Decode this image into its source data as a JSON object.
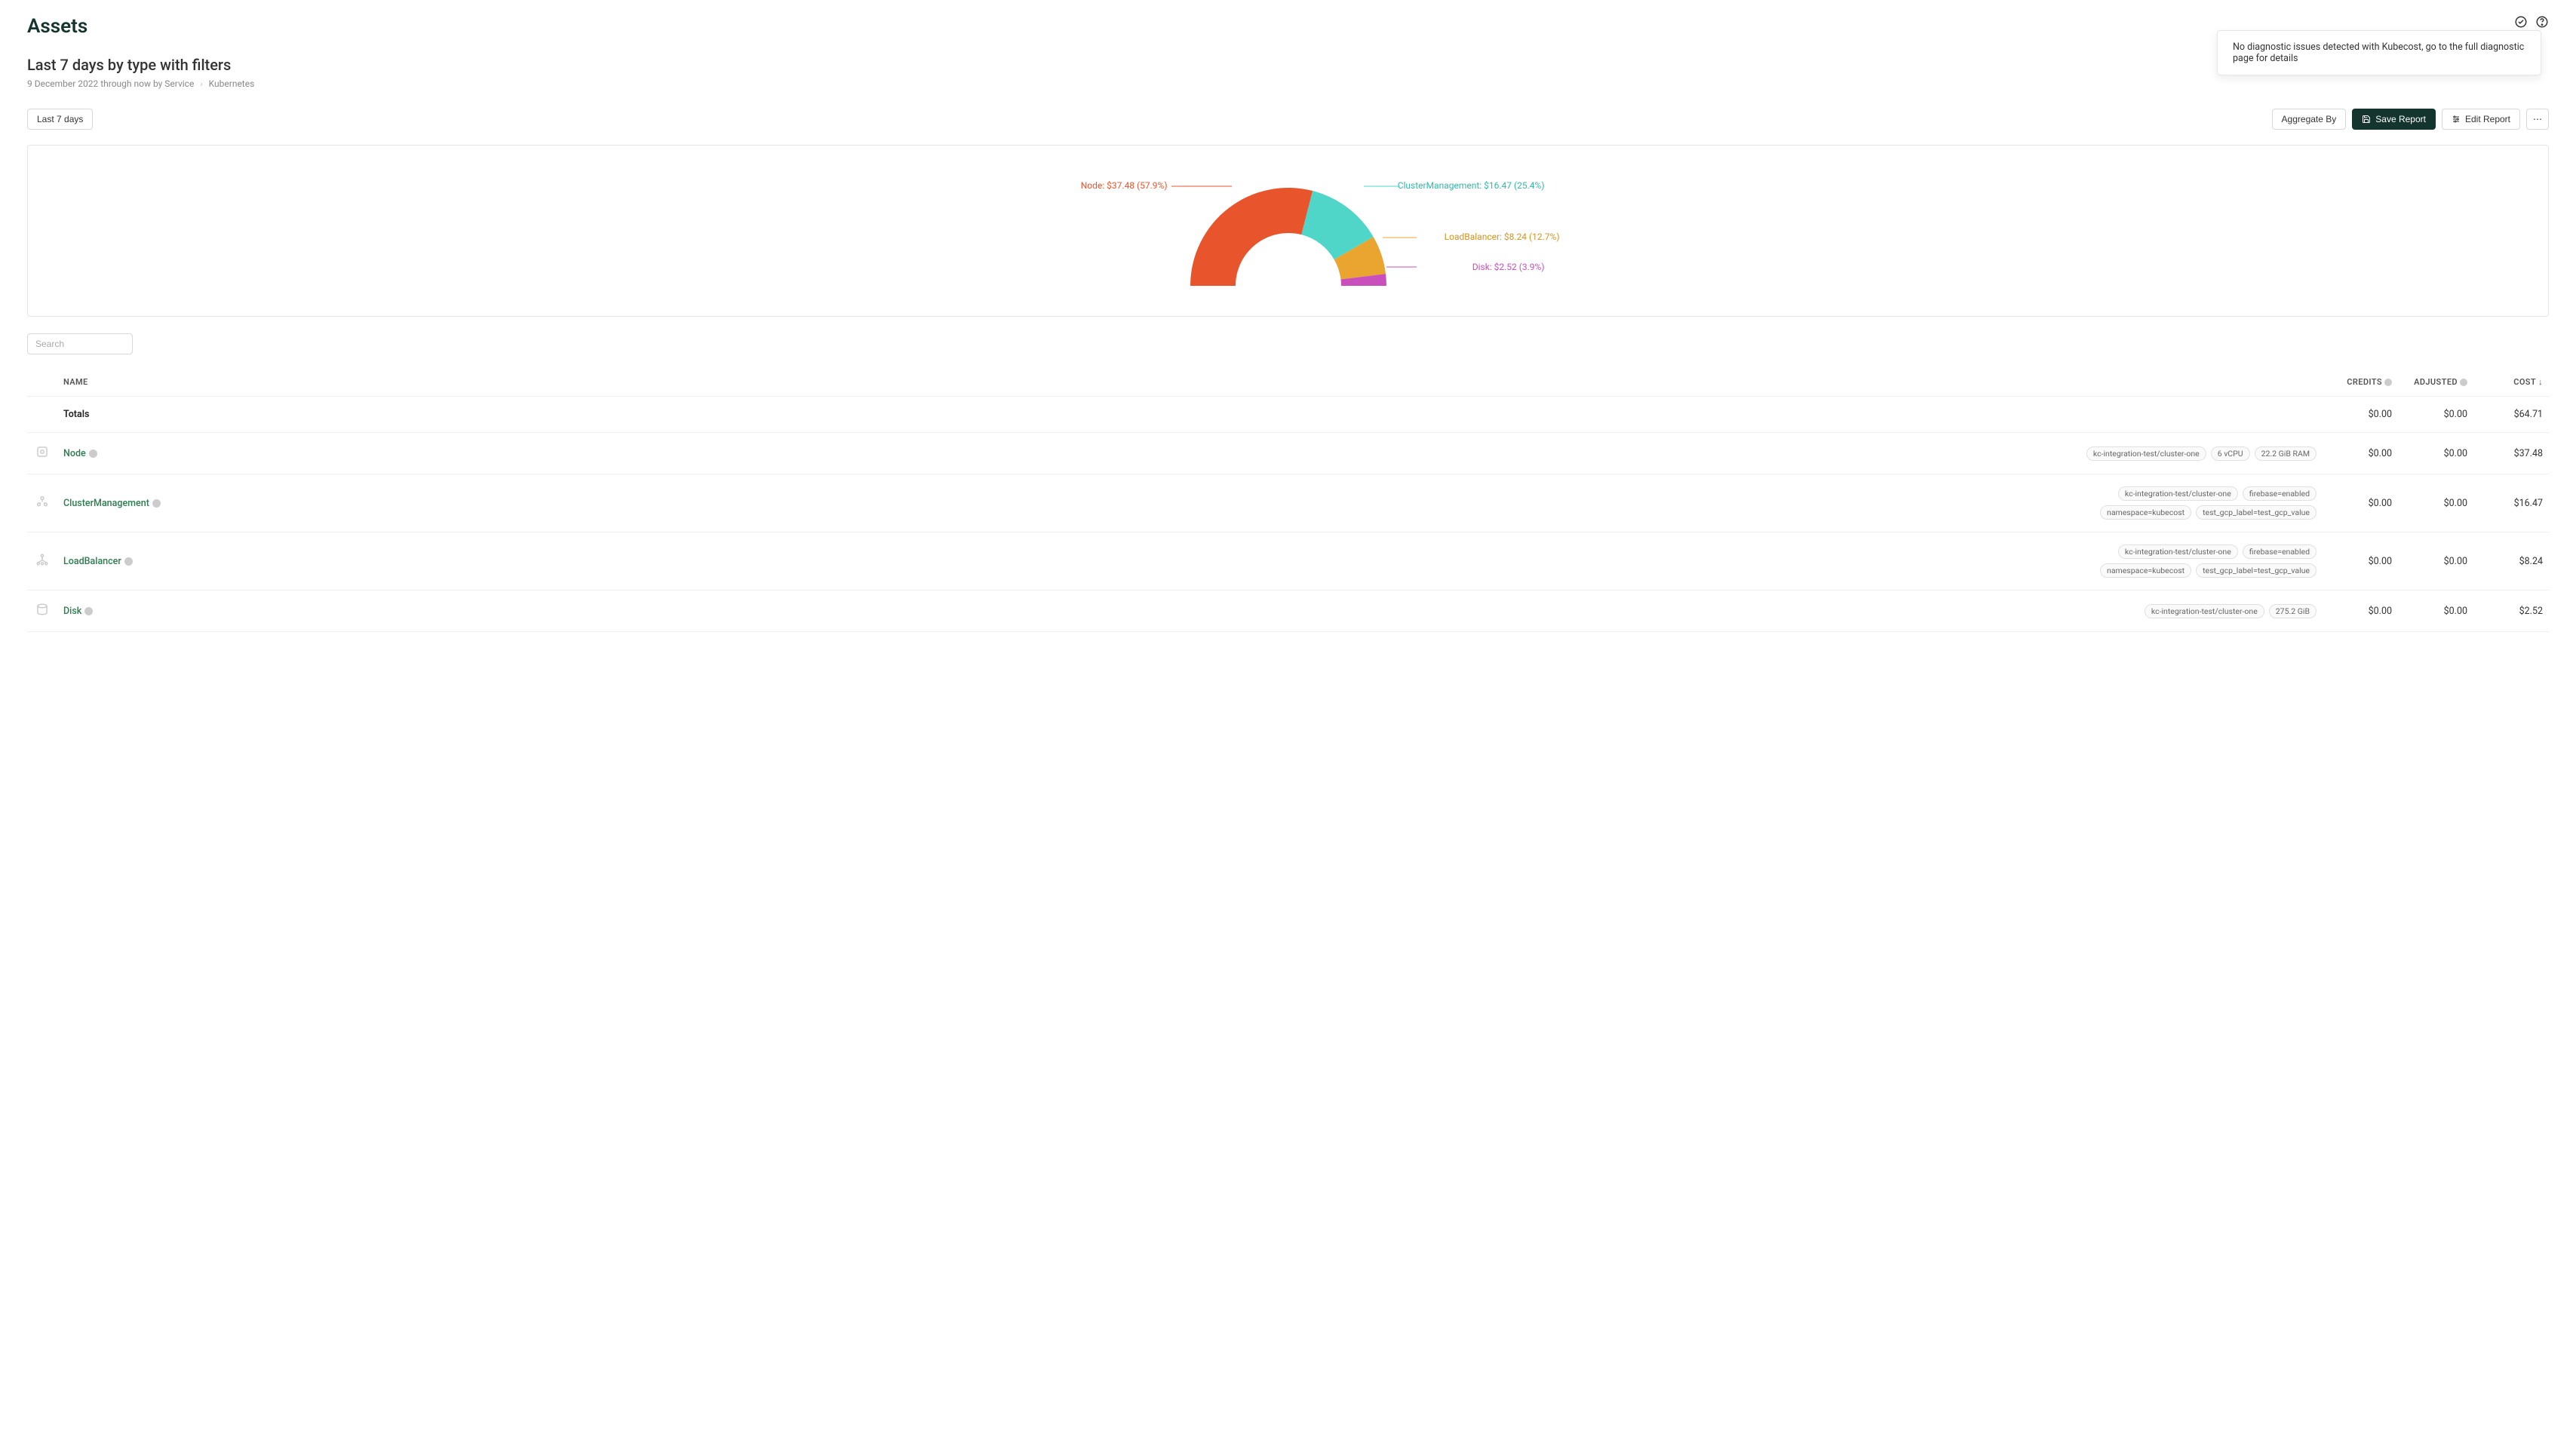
{
  "header": {
    "page_title": "Assets",
    "notification": "No diagnostic issues detected with Kubecost, go to the full diagnostic page for details"
  },
  "subheader": {
    "report_title": "Last 7 days by type with filters",
    "breadcrumb_prefix": "9 December 2022 through now by Service",
    "breadcrumb_leaf": "Kubernetes"
  },
  "toolbar": {
    "range_label": "Last 7 days",
    "aggregate_label": "Aggregate By",
    "save_label": "Save Report",
    "edit_label": "Edit Report",
    "more_label": "⋯"
  },
  "chart_data": {
    "type": "pie",
    "title": "",
    "slices": [
      {
        "name": "Node",
        "value": 37.48,
        "pct": 57.9,
        "color": "#e8552d",
        "label": "Node: $37.48 (57.9%)"
      },
      {
        "name": "ClusterManagement",
        "value": 16.47,
        "pct": 25.4,
        "color": "#4fd6c8",
        "label": "ClusterManagement: $16.47 (25.4%)"
      },
      {
        "name": "LoadBalancer",
        "value": 8.24,
        "pct": 12.7,
        "color": "#eaa531",
        "label": "LoadBalancer: $8.24 (12.7%)"
      },
      {
        "name": "Disk",
        "value": 2.52,
        "pct": 3.9,
        "color": "#c94fbd",
        "label": "Disk: $2.52 (3.9%)"
      }
    ],
    "total": 64.71
  },
  "search": {
    "placeholder": "Search"
  },
  "table": {
    "columns": {
      "name": "NAME",
      "credits": "CREDITS",
      "adjusted": "ADJUSTED",
      "cost": "COST"
    },
    "totals": {
      "name": "Totals",
      "credits": "$0.00",
      "adjusted": "$0.00",
      "cost": "$64.71"
    },
    "rows": [
      {
        "icon": "node",
        "name": "Node",
        "tags": [
          "kc-integration-test/cluster-one",
          "6 vCPU",
          "22.2 GiB RAM"
        ],
        "credits": "$0.00",
        "adjusted": "$0.00",
        "cost": "$37.48"
      },
      {
        "icon": "cluster",
        "name": "ClusterManagement",
        "tags": [
          "kc-integration-test/cluster-one",
          "firebase=enabled",
          "namespace=kubecost",
          "test_gcp_label=test_gcp_value"
        ],
        "credits": "$0.00",
        "adjusted": "$0.00",
        "cost": "$16.47"
      },
      {
        "icon": "loadbalancer",
        "name": "LoadBalancer",
        "tags": [
          "kc-integration-test/cluster-one",
          "firebase=enabled",
          "namespace=kubecost",
          "test_gcp_label=test_gcp_value"
        ],
        "credits": "$0.00",
        "adjusted": "$0.00",
        "cost": "$8.24"
      },
      {
        "icon": "disk",
        "name": "Disk",
        "tags": [
          "kc-integration-test/cluster-one",
          "275.2 GiB"
        ],
        "credits": "$0.00",
        "adjusted": "$0.00",
        "cost": "$2.52"
      }
    ]
  }
}
